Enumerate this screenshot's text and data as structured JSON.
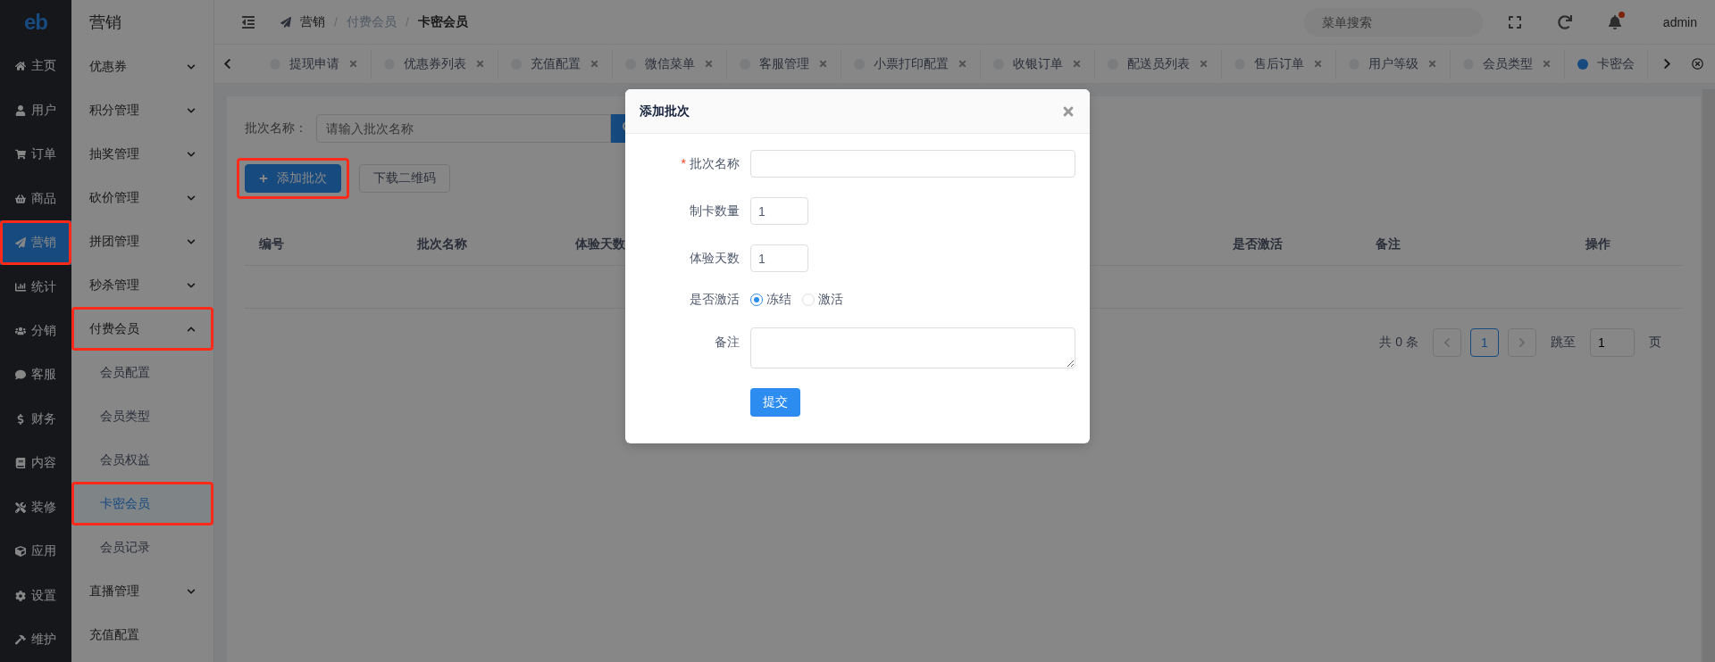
{
  "logo": "eb",
  "main_nav": [
    {
      "label": "主页",
      "selected": false,
      "annotated": false
    },
    {
      "label": "用户",
      "selected": false,
      "annotated": false
    },
    {
      "label": "订单",
      "selected": false,
      "annotated": false
    },
    {
      "label": "商品",
      "selected": false,
      "annotated": false
    },
    {
      "label": "营销",
      "selected": true,
      "annotated": true
    },
    {
      "label": "统计",
      "selected": false,
      "annotated": false
    },
    {
      "label": "分销",
      "selected": false,
      "annotated": false
    },
    {
      "label": "客服",
      "selected": false,
      "annotated": false
    },
    {
      "label": "财务",
      "selected": false,
      "annotated": false
    },
    {
      "label": "内容",
      "selected": false,
      "annotated": false
    },
    {
      "label": "装修",
      "selected": false,
      "annotated": false
    },
    {
      "label": "应用",
      "selected": false,
      "annotated": false
    },
    {
      "label": "设置",
      "selected": false,
      "annotated": false
    },
    {
      "label": "维护",
      "selected": false,
      "annotated": false
    }
  ],
  "sub_nav": {
    "title": "营销",
    "items": [
      {
        "label": "优惠券",
        "kind": "group",
        "expanded": false,
        "annotated": false
      },
      {
        "label": "积分管理",
        "kind": "group",
        "expanded": false,
        "annotated": false
      },
      {
        "label": "抽奖管理",
        "kind": "group",
        "expanded": false,
        "annotated": false
      },
      {
        "label": "砍价管理",
        "kind": "group",
        "expanded": false,
        "annotated": false
      },
      {
        "label": "拼团管理",
        "kind": "group",
        "expanded": false,
        "annotated": false
      },
      {
        "label": "秒杀管理",
        "kind": "group",
        "expanded": false,
        "annotated": false
      },
      {
        "label": "付费会员",
        "kind": "group",
        "expanded": true,
        "annotated": true,
        "children": [
          {
            "label": "会员配置",
            "selected": false,
            "annotated": false
          },
          {
            "label": "会员类型",
            "selected": false,
            "annotated": false
          },
          {
            "label": "会员权益",
            "selected": false,
            "annotated": false
          },
          {
            "label": "卡密会员",
            "selected": true,
            "annotated": true
          },
          {
            "label": "会员记录",
            "selected": false,
            "annotated": false
          }
        ]
      },
      {
        "label": "直播管理",
        "kind": "group",
        "expanded": false,
        "annotated": false
      },
      {
        "label": "充值配置",
        "kind": "link",
        "annotated": false
      }
    ]
  },
  "breadcrumb": [
    "营销",
    "付费会员",
    "卡密会员"
  ],
  "breadcrumb_separators": [
    "/",
    "/"
  ],
  "header": {
    "search": {
      "placeholder": "菜单搜索"
    },
    "notification_dot": true,
    "user": "admin"
  },
  "tabs": [
    {
      "label": "提现申请",
      "selected": false
    },
    {
      "label": "优惠券列表",
      "selected": false
    },
    {
      "label": "充值配置",
      "selected": false
    },
    {
      "label": "微信菜单",
      "selected": false
    },
    {
      "label": "客服管理",
      "selected": false
    },
    {
      "label": "小票打印配置",
      "selected": false
    },
    {
      "label": "收银订单",
      "selected": false
    },
    {
      "label": "配送员列表",
      "selected": false
    },
    {
      "label": "售后订单",
      "selected": false
    },
    {
      "label": "用户等级",
      "selected": false
    },
    {
      "label": "会员类型",
      "selected": false
    },
    {
      "label": "卡密会",
      "selected": true
    }
  ],
  "filter": {
    "label": "批次名称：",
    "placeholder": "请输入批次名称"
  },
  "actions": [
    {
      "label": "添加批次",
      "kind": "primary",
      "annotated": true
    },
    {
      "label": "下载二维码",
      "kind": "default"
    }
  ],
  "table": {
    "columns": [
      "编号",
      "批次名称",
      "体验天数",
      "是否激活",
      "备注",
      "操作"
    ]
  },
  "pagination": {
    "total": "共 0 条",
    "pages": [
      {
        "label": "1",
        "selected": true
      }
    ],
    "jump_label": "跳至",
    "jump_value": "1",
    "jump_unit": "页"
  },
  "dialog": {
    "title": "添加批次",
    "fields": [
      {
        "label": "批次名称",
        "kind": "text",
        "required_mark": "*"
      },
      {
        "label": "制卡数量",
        "kind": "number",
        "value": "1"
      },
      {
        "label": "体验天数",
        "kind": "number",
        "value": "1"
      },
      {
        "label": "是否激活",
        "kind": "radio",
        "options": [
          {
            "label": "冻结",
            "selected": true
          },
          {
            "label": "激活",
            "selected": false
          }
        ]
      },
      {
        "label": "备注",
        "kind": "textarea"
      }
    ],
    "submit": "提交"
  }
}
